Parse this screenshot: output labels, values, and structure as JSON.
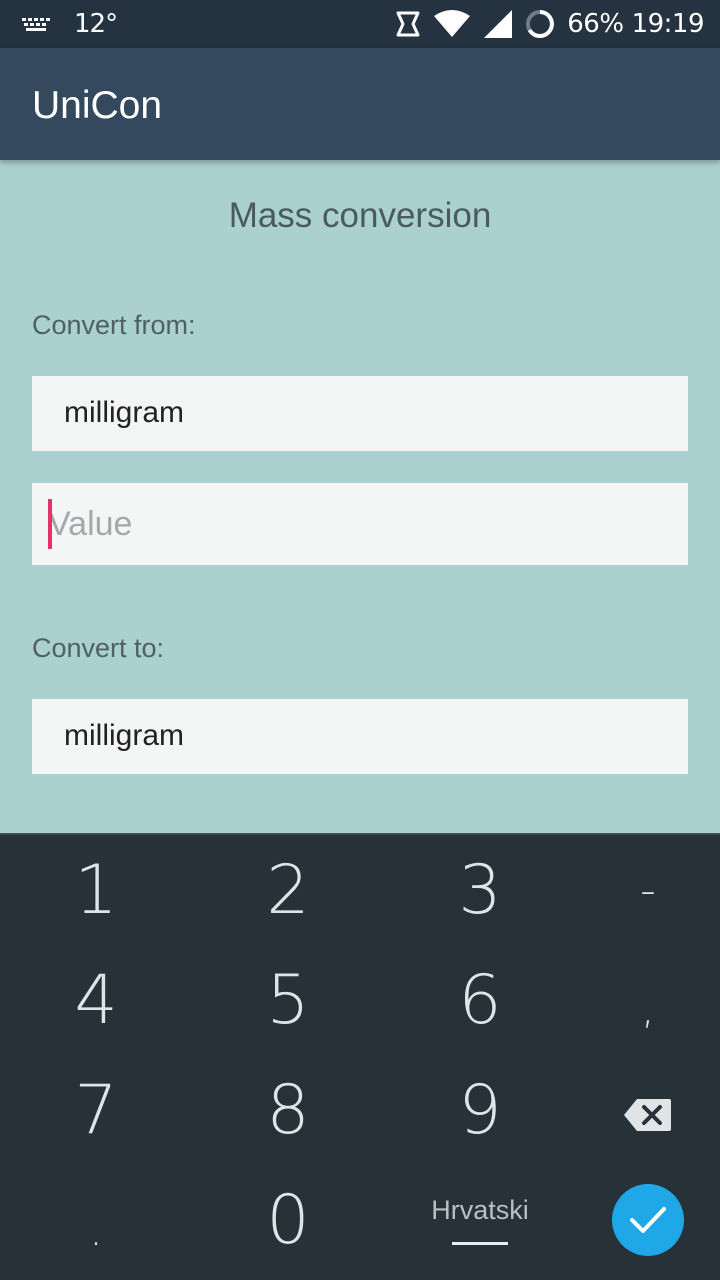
{
  "status_bar": {
    "temperature": "12°",
    "battery_percent": "66%",
    "time": "19:19"
  },
  "app_bar": {
    "title": "UniCon"
  },
  "content": {
    "section_title": "Mass conversion",
    "from_label": "Convert from:",
    "from_unit": "milligram",
    "value_placeholder": "Value",
    "to_label": "Convert to:",
    "to_unit": "milligram"
  },
  "keyboard": {
    "keys": {
      "k1": "1",
      "k2": "2",
      "k3": "3",
      "minus": "-",
      "k4": "4",
      "k5": "5",
      "k6": "6",
      "comma": ",",
      "k7": "7",
      "k8": "8",
      "k9": "9",
      "dot": ".",
      "k0": "0"
    },
    "language": "Hrvatski"
  },
  "colors": {
    "accent": "#1fa8e8",
    "cursor": "#e2336b",
    "app_bar": "#34495e",
    "background": "#aad0cf"
  }
}
